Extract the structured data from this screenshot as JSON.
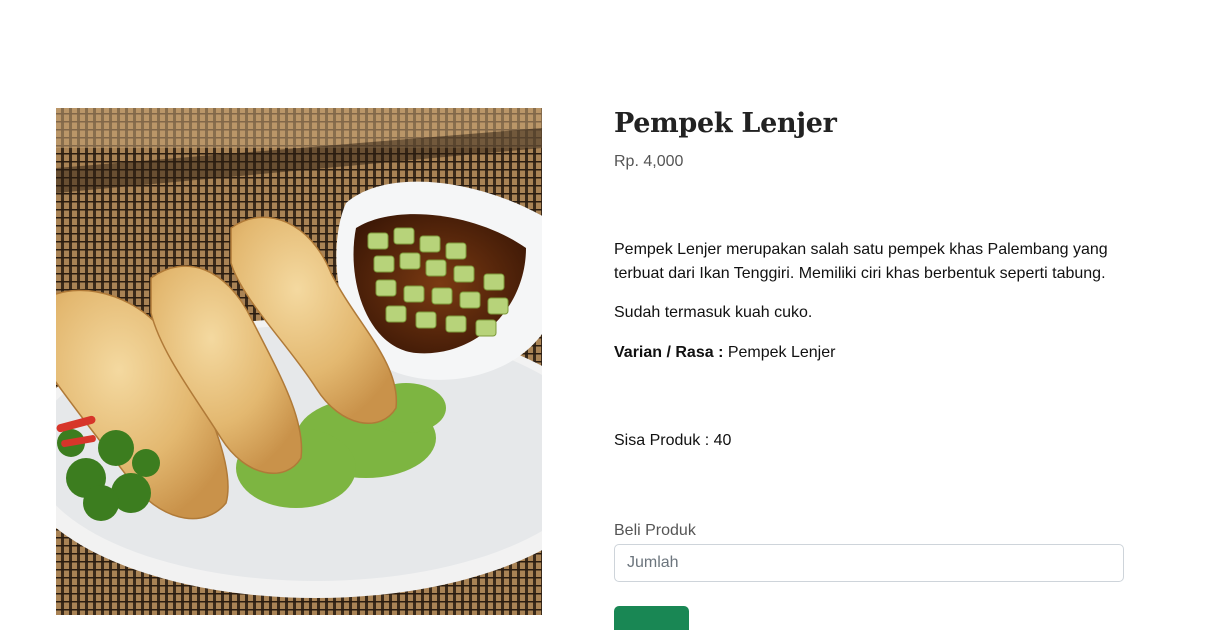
{
  "product": {
    "name": "Pempek Lenjer",
    "price": "Rp. 4,000",
    "description": "Pempek Lenjer merupakan salah satu pempek khas Palembang yang terbuat dari Ikan Tenggiri. Memiliki ciri khas berbentuk seperti tabung.",
    "note": "Sudah termasuk kuah cuko.",
    "variant_label": "Varian / Rasa :",
    "variant_value": "Pempek Lenjer",
    "stock_text": "Sisa Produk : 40"
  },
  "purchase": {
    "label": "Beli Produk",
    "quantity_placeholder": "Jumlah",
    "quantity_value": ""
  },
  "colors": {
    "buy_button": "#198754"
  }
}
